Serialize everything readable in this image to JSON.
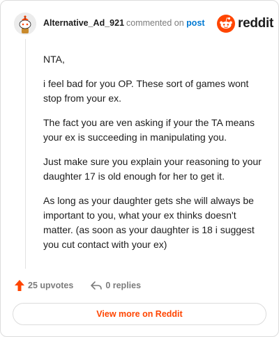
{
  "header": {
    "username": "Alternative_Ad_921",
    "commented_on": "commented on",
    "post_link": "post",
    "brand": "reddit"
  },
  "comment": {
    "paragraphs": [
      "NTA,",
      "i feel bad for you OP. These sort of games wont stop from your ex.",
      "The fact you are ven asking if your the TA means your ex is succeeding in manipulating you.",
      "Just make sure you explain your reasoning to your daughter 17 is old enough for her to get it.",
      "As long as your daughter gets she will always be important to you, what your ex thinks doesn't matter. (as soon as your daughter is 18 i suggest you cut contact with your ex)"
    ]
  },
  "actions": {
    "upvotes": "25 upvotes",
    "replies": "0 replies"
  },
  "footer": {
    "view_button": "View more on Reddit"
  },
  "icons": {
    "avatar": "snoo-avatar-icon",
    "brand": "reddit-logo-icon",
    "upvote": "upvote-arrow-icon",
    "reply": "reply-arrow-icon"
  },
  "colors": {
    "brand_orange": "#ff4500",
    "link_blue": "#0079d3",
    "muted": "#7c7c7c"
  }
}
